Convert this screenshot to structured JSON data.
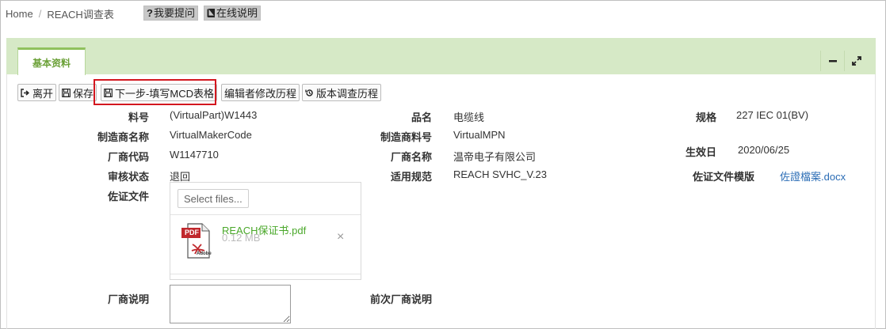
{
  "breadcrumb": {
    "home": "Home",
    "separator": "/",
    "current": "REACH调查表"
  },
  "top_buttons": [
    {
      "icon": "?",
      "label": "我要提问"
    },
    {
      "icon": "book-icon",
      "label": "在线说明"
    }
  ],
  "tab": {
    "label": "基本资料"
  },
  "toolbar": {
    "leave": "离开",
    "save": "保存",
    "next_step": "下一步-填写MCD表格",
    "editor_history": "编辑者修改历程",
    "version_history": "版本调查历程"
  },
  "fields": {
    "part_no": {
      "label": "料号",
      "value": "(VirtualPart)W1443"
    },
    "product_name": {
      "label": "品名",
      "value": "电缆线"
    },
    "spec": {
      "label": "规格",
      "value": "227 IEC 01(BV)"
    },
    "maker_name": {
      "label": "制造商名称",
      "value": "VirtualMakerCode"
    },
    "maker_part_no": {
      "label": "制造商料号",
      "value": "VirtualMPN"
    },
    "vendor_code": {
      "label": "厂商代码",
      "value": "W1147710"
    },
    "vendor_name": {
      "label": "厂商名称",
      "value": "温帝电子有限公司"
    },
    "effective_date": {
      "label": "生效日",
      "value": "2020/06/25"
    },
    "review_status": {
      "label": "审核状态",
      "value": "退回"
    },
    "applicable_spec": {
      "label": "适用规范",
      "value": "REACH SVHC_V.23"
    },
    "evidence_template": {
      "label": "佐证文件模版",
      "value": "佐證檔案.docx"
    },
    "evidence_file": {
      "label": "佐证文件"
    },
    "vendor_note": {
      "label": "厂商说明"
    },
    "previous_vendor_note": {
      "label": "前次厂商说明"
    }
  },
  "upload": {
    "select_label": "Select files...",
    "file": {
      "name": "REACH保证书.pdf",
      "size": "0.12 MB",
      "type_badge": "PDF",
      "brand": "Adobe"
    },
    "remove_icon": "×"
  },
  "colors": {
    "tab_accent": "#8fc15d",
    "panel_header": "#d6e9c6",
    "highlight": "#d3171f",
    "link": "#2a6cb5",
    "file_name": "#4aa82a"
  }
}
